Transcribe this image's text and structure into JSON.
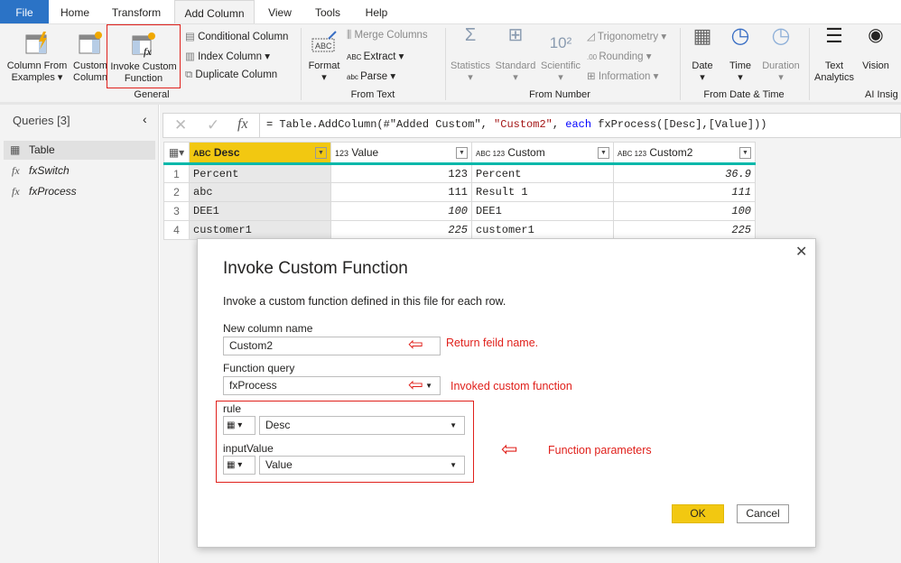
{
  "tabs": {
    "file": "File",
    "home": "Home",
    "transform": "Transform",
    "add_column": "Add Column",
    "view": "View",
    "tools": "Tools",
    "help": "Help"
  },
  "ribbon": {
    "column_from_examples": [
      "Column From",
      "Examples ▾"
    ],
    "custom_column": [
      "Custom",
      "Column"
    ],
    "invoke_custom_function": [
      "Invoke Custom",
      "Function"
    ],
    "conditional_column": "Conditional Column",
    "index_column": "Index Column ▾",
    "duplicate_column": "Duplicate Column",
    "general": "General",
    "format": "Format",
    "merge_columns": "Merge Columns",
    "extract": "Extract ▾",
    "parse": "Parse ▾",
    "from_text": "From Text",
    "statistics": "Statistics",
    "standard": "Standard",
    "scientific": "Scientific",
    "trigonometry": "Trigonometry ▾",
    "rounding": "Rounding ▾",
    "information": "Information ▾",
    "from_number": "From Number",
    "date": "Date",
    "time": "Time",
    "duration": "Duration",
    "from_date_time": "From Date & Time",
    "text_analytics": [
      "Text",
      "Analytics"
    ],
    "vision": "Vision",
    "ai_insights": "AI Insig",
    "highlight_color": "#e0201b"
  },
  "queries": {
    "title": "Queries [3]",
    "items": [
      "Table",
      "fxSwitch",
      "fxProcess"
    ]
  },
  "formula": "= Table.AddColumn(#\"Added Custom\", \"Custom2\", each fxProcess([Desc],[Value]))",
  "formula_parts": [
    "= Table.AddColumn(#\"Added Custom\", ",
    "\"Custom2\"",
    ", ",
    "each",
    " fxProcess([Desc],[Value]))"
  ],
  "table": {
    "columns": [
      {
        "type": "ABC",
        "name": "Desc"
      },
      {
        "type": "123",
        "name": "Value"
      },
      {
        "type": "ABC 123",
        "name": "Custom"
      },
      {
        "type": "ABC 123",
        "name": "Custom2"
      }
    ],
    "rows": [
      [
        "1",
        "Percent",
        "123",
        "Percent",
        "36.9"
      ],
      [
        "2",
        "abc",
        "111",
        "Result 1",
        "111"
      ],
      [
        "3",
        "DEE1",
        "100",
        "DEE1",
        "100"
      ],
      [
        "4",
        "customer1",
        "225",
        "customer1",
        "225"
      ]
    ]
  },
  "dialog": {
    "title": "Invoke Custom Function",
    "description": "Invoke a custom function defined in this file for each row.",
    "new_column_label": "New column name",
    "new_column_value": "Custom2",
    "function_query_label": "Function query",
    "function_query_value": "fxProcess",
    "rule_label": "rule",
    "rule_value": "Desc",
    "input_value_label": "inputValue",
    "input_value_value": "Value",
    "ok": "OK",
    "cancel": "Cancel",
    "ok_color": "#f2c811"
  },
  "annotations": {
    "return_name": "Return feild name.",
    "invoked": "Invoked custom function",
    "params": "Function parameters"
  }
}
